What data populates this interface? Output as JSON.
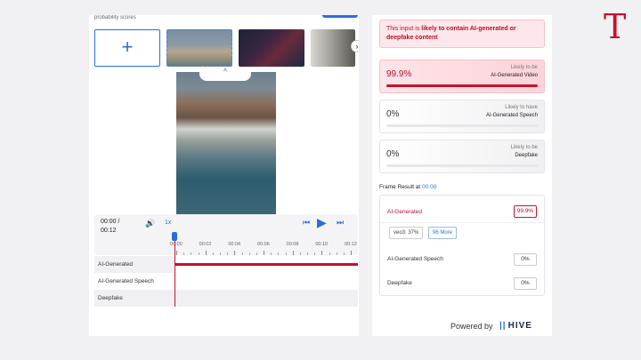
{
  "left": {
    "caption": "probability scores",
    "add_label": "+",
    "next_label": "›",
    "video_tab_label": "^",
    "controls": {
      "time": "00:00 / 00:12",
      "volume_icon": "🔊",
      "speed": "1x",
      "prev_icon": "⏮",
      "play_icon": "▶",
      "skip_icon": "⏭",
      "ticks": [
        "00:00",
        "00:02",
        "00:04",
        "00:06",
        "00:08",
        "00:10",
        "00:12"
      ]
    },
    "tracks": [
      {
        "label": "AI-Generated",
        "fill": 1.0
      },
      {
        "label": "AI-Generated Speech",
        "fill": 0
      },
      {
        "label": "Deepfake",
        "fill": 0
      }
    ]
  },
  "right": {
    "alert": {
      "prefix": "This input is ",
      "strong": "likely to contain AI-generated or deepfake content"
    },
    "cards": [
      {
        "value": "99.9%",
        "sub_top": "Likely to be",
        "sub_bottom": "AI-Generated Video",
        "fill": 0.999
      },
      {
        "value": "0%",
        "sub_top": "Likely to have",
        "sub_bottom": "AI-Generated Speech",
        "fill": 0
      },
      {
        "value": "0%",
        "sub_top": "Likely to be",
        "sub_bottom": "Deepfake",
        "fill": 0
      }
    ],
    "frame": {
      "title_prefix": "Frame Result at ",
      "title_time": "00:00",
      "ai_label": "AI-Generated",
      "ai_value": "99.9%",
      "chip_1": "veo3: 37%",
      "chip_2": "96 More",
      "speech_label": "AI-Generated Speech",
      "speech_value": "0%",
      "deepfake_label": "Deepfake",
      "deepfake_value": "0%"
    },
    "powered_by": "Powered by",
    "brand": "HIVE",
    "brand_mark": "||"
  },
  "corner_logo": "T",
  "colors": {
    "accent": "#2a6fd6",
    "danger": "#c8102e"
  }
}
